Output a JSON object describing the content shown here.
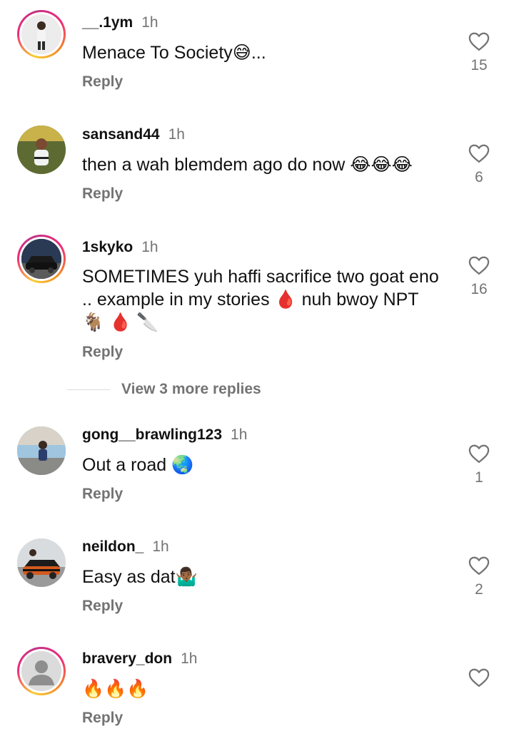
{
  "comments": [
    {
      "username": "__.1ym",
      "time": "1h",
      "text": "Menace To Society😅...",
      "reply": "Reply",
      "likes": "15",
      "story_ring": true
    },
    {
      "username": "sansand44",
      "time": "1h",
      "text": "then a wah blemdem ago do now 😂😂😂",
      "reply": "Reply",
      "likes": "6",
      "story_ring": false
    },
    {
      "username": "1skyko",
      "time": "1h",
      "text": "SOMETIMES yuh haffi sacrifice two goat eno .. example in my stories 🩸 nuh bwoy NPT 🐐 🩸 🔪",
      "reply": "Reply",
      "likes": "16",
      "story_ring": true
    },
    {
      "username": "gong__brawling123",
      "time": "1h",
      "text": "Out a road 🌏",
      "reply": "Reply",
      "likes": "1",
      "story_ring": false
    },
    {
      "username": "neildon_",
      "time": "1h",
      "text": "Easy as dat🤷🏾‍♂️",
      "reply": "Reply",
      "likes": "2",
      "story_ring": false
    },
    {
      "username": "bravery_don",
      "time": "1h",
      "text": "🔥🔥🔥",
      "reply": "Reply",
      "likes": "",
      "story_ring": true
    }
  ],
  "view_more_replies": "View 3 more replies",
  "colors": {
    "secondary_text": "#737373",
    "primary_text": "#111111",
    "ring_start": "#f9ce34",
    "ring_mid": "#ee2a7b"
  }
}
